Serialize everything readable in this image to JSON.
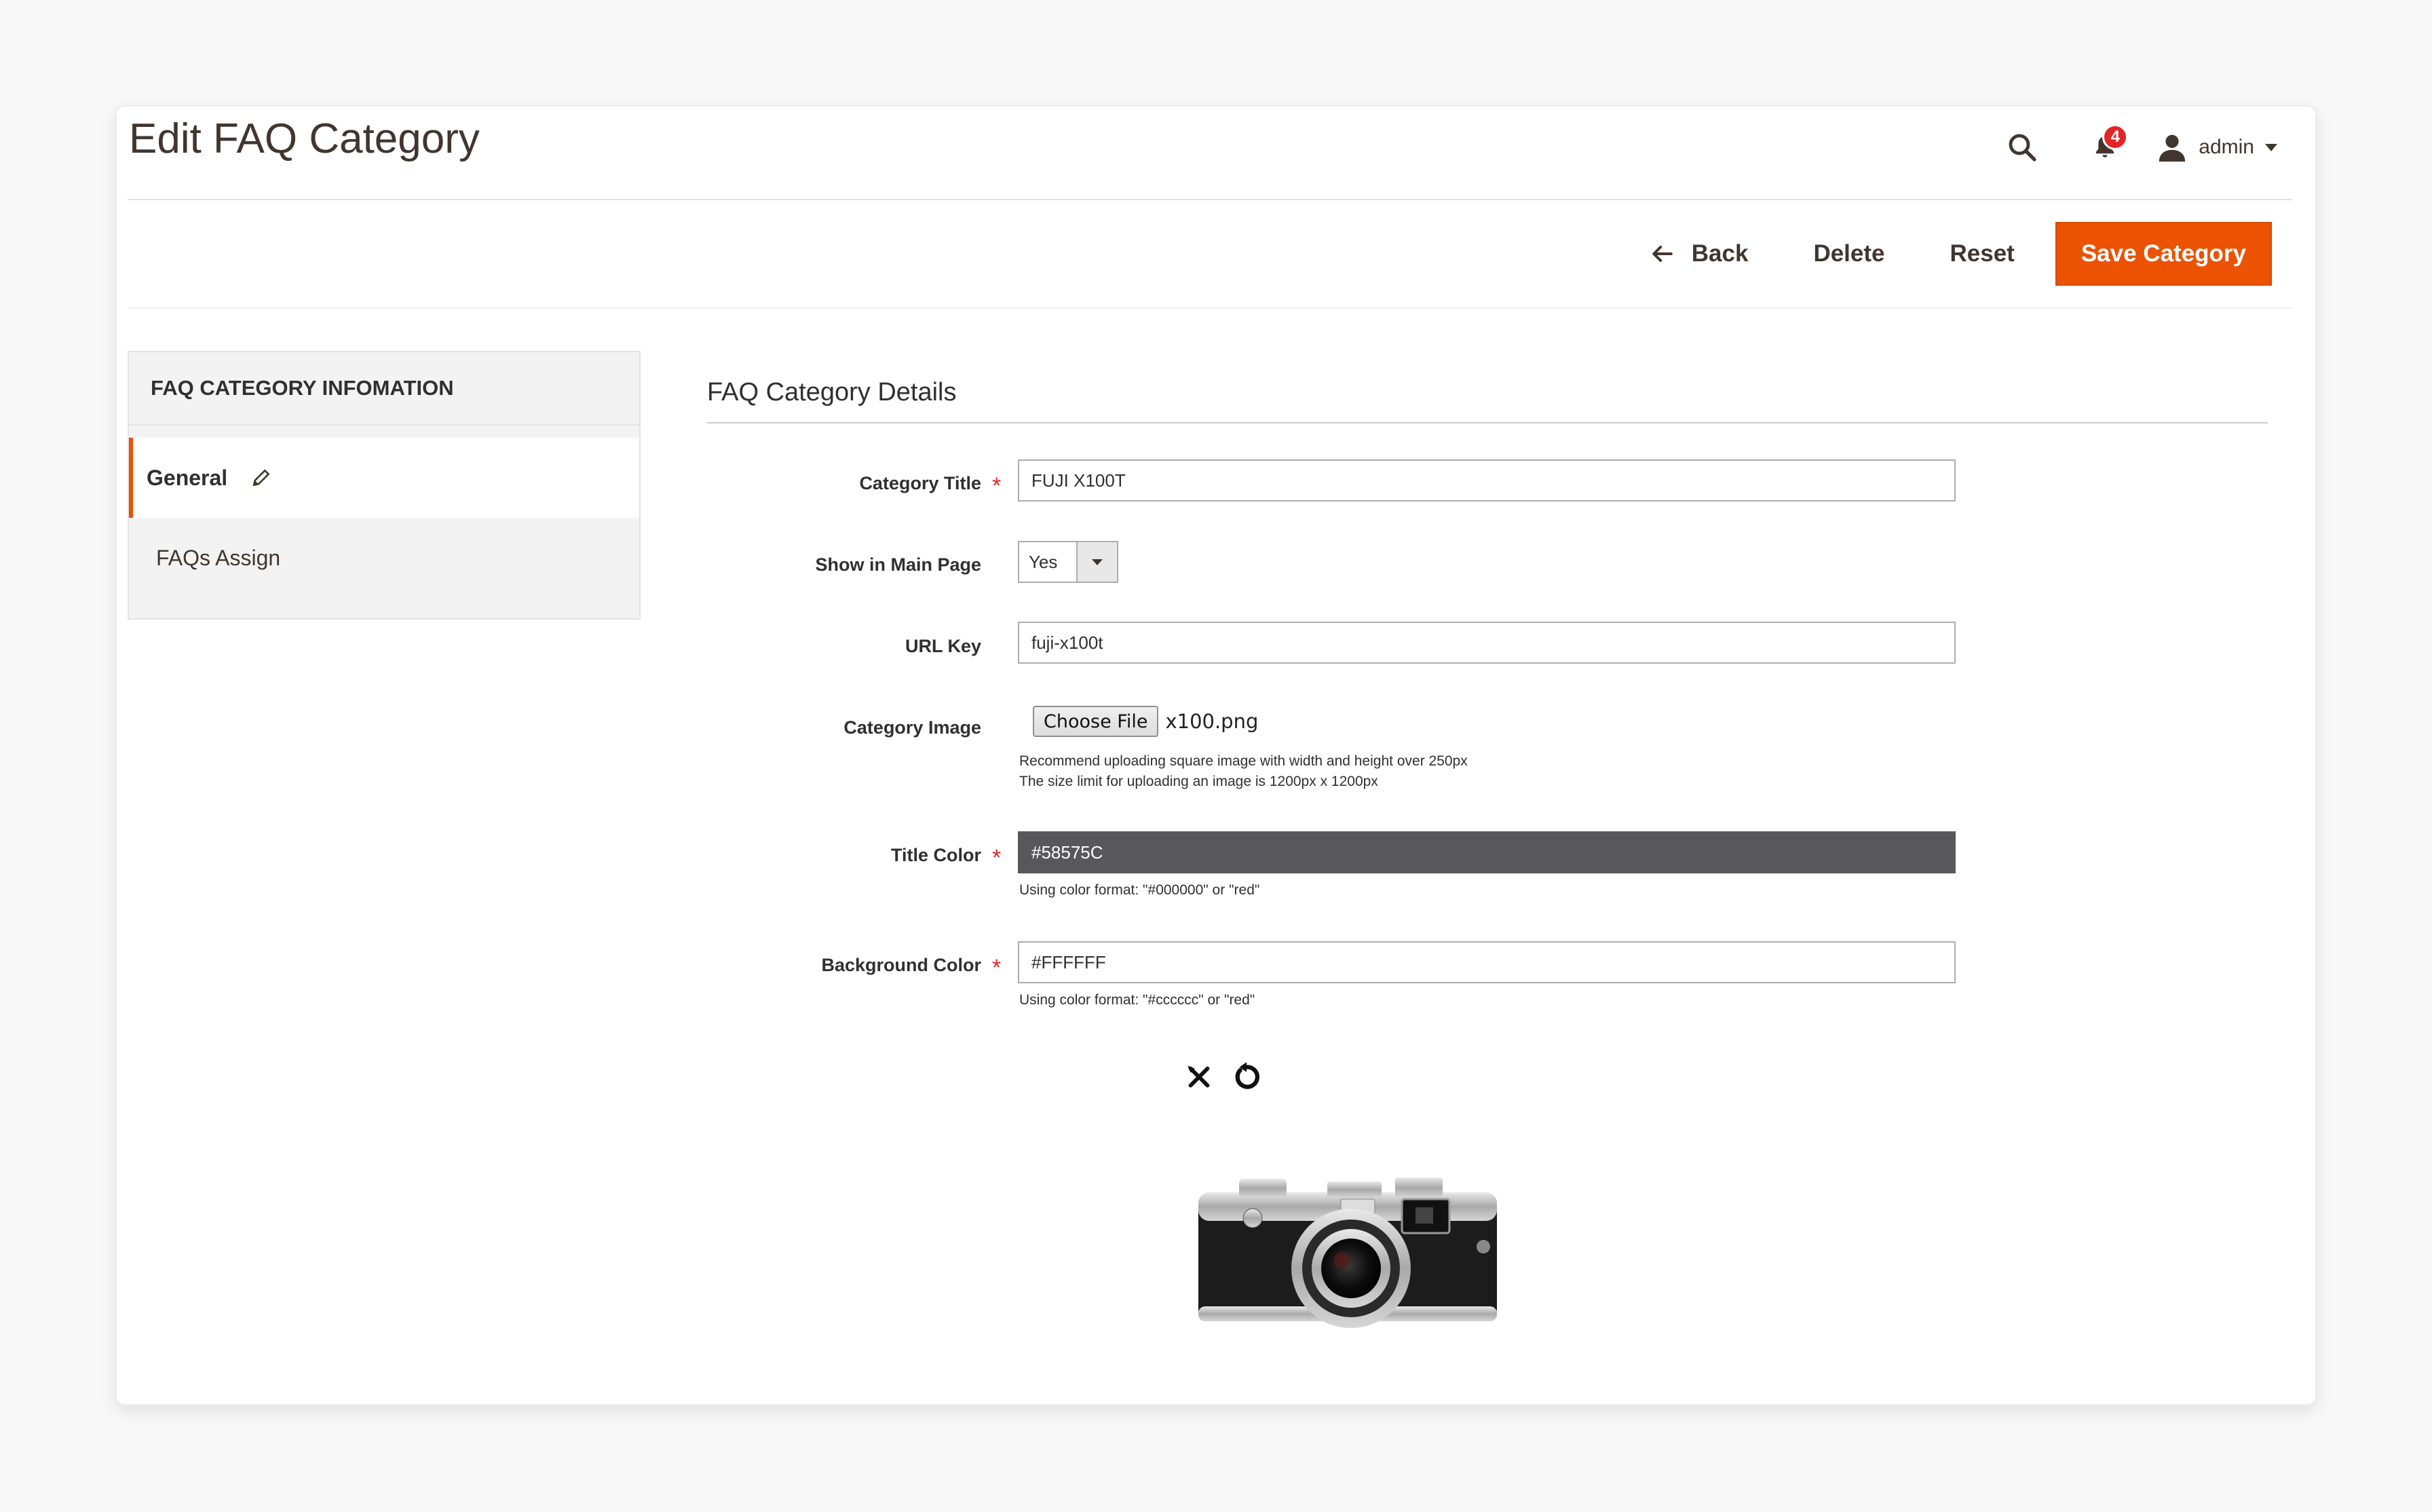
{
  "header": {
    "page_title": "Edit FAQ Category",
    "notification_count": "4",
    "user_name": "admin"
  },
  "actions": {
    "back": "Back",
    "delete": "Delete",
    "reset": "Reset",
    "save": "Save Category"
  },
  "sidebar": {
    "heading": "FAQ CATEGORY INFOMATION",
    "items": [
      {
        "label": "General",
        "active": true
      },
      {
        "label": "FAQs Assign",
        "active": false
      }
    ]
  },
  "form": {
    "section_title": "FAQ Category Details",
    "category_title": {
      "label": "Category Title",
      "value": "FUJI X100T",
      "required": true
    },
    "show_in_main": {
      "label": "Show in Main Page",
      "value": "Yes"
    },
    "url_key": {
      "label": "URL Key",
      "value": "fuji-x100t"
    },
    "category_image": {
      "label": "Category Image",
      "button": "Choose File",
      "file_name": "x100.png",
      "note_1": "Recommend uploading square image with width and height over 250px",
      "note_2": "The size limit for uploading an image is 1200px x 1200px"
    },
    "title_color": {
      "label": "Title Color",
      "value": "#58575C",
      "note": "Using color format: \"#000000\" or \"red\"",
      "required": true
    },
    "background_color": {
      "label": "Background Color",
      "value": "#FFFFFF",
      "note": "Using color format: \"#cccccc\" or \"red\"",
      "required": true
    }
  },
  "colors": {
    "accent": "#eb5202",
    "required": "#e22626",
    "title_color_swatch": "#58575c",
    "text": "#303030"
  },
  "icons": [
    "search-icon",
    "bell-icon",
    "user-icon",
    "back-arrow-icon",
    "pencil-icon",
    "remove-image-icon",
    "restore-image-icon",
    "camera-image"
  ]
}
